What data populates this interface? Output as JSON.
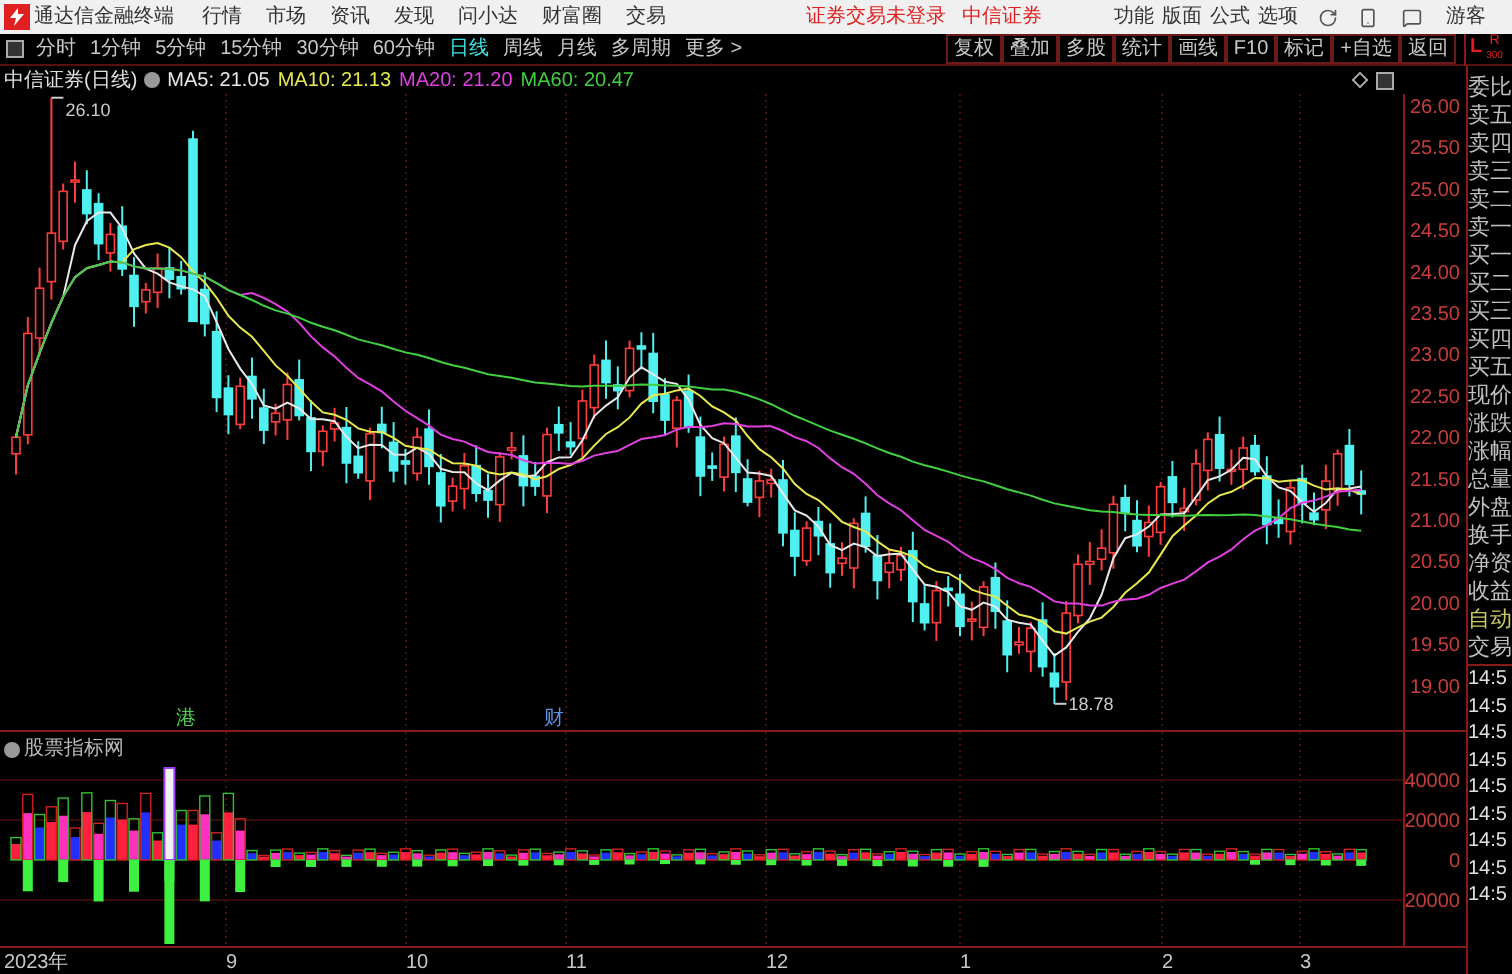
{
  "menu_bar": {
    "app_name": "通达信金融终端",
    "menus": [
      "行情",
      "市场",
      "资讯",
      "发现",
      "问小达",
      "财富圈",
      "交易"
    ],
    "login_status": "证券交易未登录",
    "broker": "中信证券",
    "tools": [
      "功能",
      "版面",
      "公式",
      "选项"
    ],
    "user": "游客"
  },
  "period_tabs": [
    {
      "label": "分时",
      "selected": false
    },
    {
      "label": "1分钟",
      "selected": false
    },
    {
      "label": "5分钟",
      "selected": false
    },
    {
      "label": "15分钟",
      "selected": false
    },
    {
      "label": "30分钟",
      "selected": false
    },
    {
      "label": "60分钟",
      "selected": false
    },
    {
      "label": "日线",
      "selected": true
    },
    {
      "label": "周线",
      "selected": false
    },
    {
      "label": "月线",
      "selected": false
    },
    {
      "label": "多周期",
      "selected": false
    },
    {
      "label": "更多 >",
      "selected": false
    }
  ],
  "tool_buttons": [
    "复权",
    "叠加",
    "多股",
    "统计",
    "画线",
    "F10",
    "标记",
    "+自选",
    "返回"
  ],
  "quote_panel": {
    "header_left": "L",
    "header_right": "R",
    "header_sub": "300",
    "labels": [
      "委比",
      "卖五",
      "卖四",
      "卖三",
      "卖二",
      "卖一",
      "买一",
      "买二",
      "买三",
      "买四",
      "买五",
      "现价",
      "涨跌",
      "涨幅",
      "总量",
      "外盘",
      "换手",
      "净资",
      "收益"
    ],
    "mode": "自动",
    "trade": "交易",
    "times": [
      "14:5",
      "14:5",
      "14:5",
      "14:5",
      "14:5",
      "14:5",
      "14:5",
      "14:5",
      "14:5"
    ]
  },
  "chart": {
    "title": "中信证券(日线)",
    "ma": [
      {
        "label": "MA5: 21.05",
        "color": "#e8e8e8"
      },
      {
        "label": "MA10: 21.13",
        "color": "#e8e850"
      },
      {
        "label": "MA20: 21.20",
        "color": "#e040e0"
      },
      {
        "label": "MA60: 20.47",
        "color": "#40d040"
      }
    ],
    "price_ticks": [
      "26.00",
      "25.50",
      "25.00",
      "24.50",
      "24.00",
      "23.50",
      "23.00",
      "22.50",
      "22.00",
      "21.50",
      "21.00",
      "20.50",
      "20.00",
      "19.50",
      "19.00"
    ],
    "high_marker": "26.10",
    "low_marker": "18.78",
    "event_markers": [
      {
        "text": "港",
        "color": "#50d050"
      },
      {
        "text": "财",
        "color": "#6090e0"
      }
    ]
  },
  "indicator": {
    "title": "股票指标网",
    "ticks": [
      "40000",
      "20000",
      "0",
      "20000"
    ]
  },
  "date_axis": [
    "2023年",
    "9",
    "10",
    "11",
    "12",
    "1",
    "2",
    "3"
  ]
}
